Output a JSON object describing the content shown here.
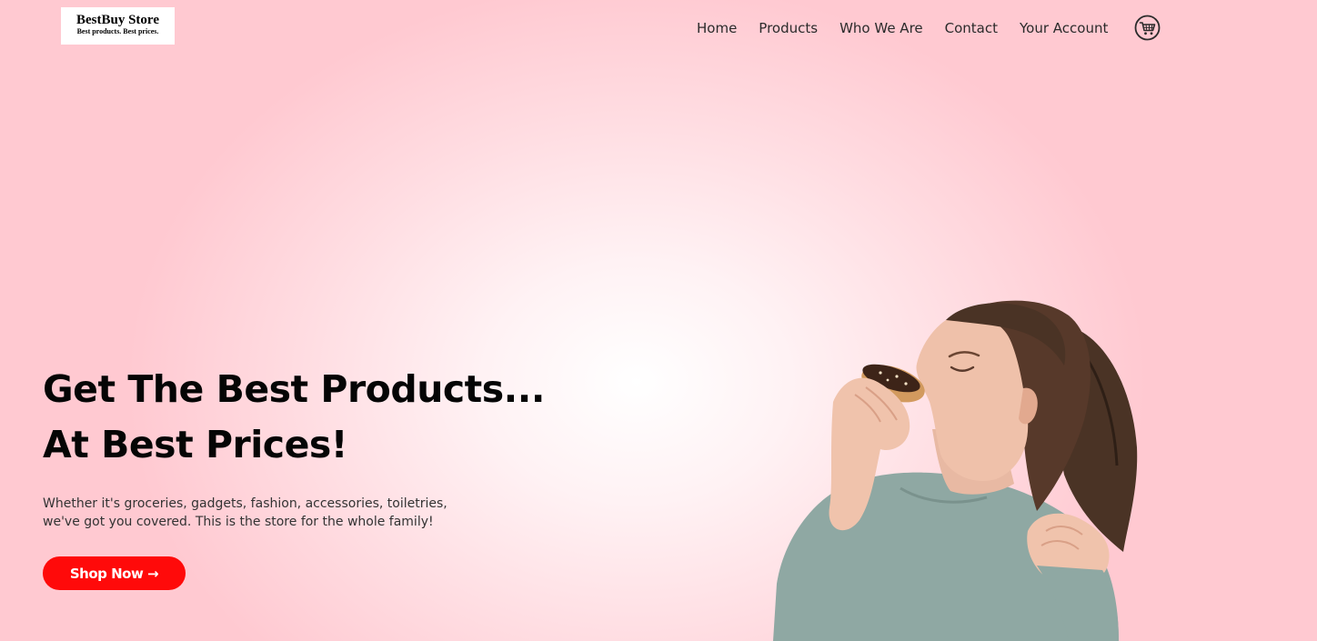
{
  "header": {
    "logo": {
      "name": "BestBuy Store",
      "tagline": "Best products. Best prices."
    },
    "nav": [
      {
        "label": "Home"
      },
      {
        "label": "Products"
      },
      {
        "label": "Who We Are"
      },
      {
        "label": "Contact"
      },
      {
        "label": "Your Account"
      }
    ],
    "cart_icon": "shopping-cart-icon"
  },
  "hero": {
    "title_line1": "Get The Best Products...",
    "title_line2": "At Best Prices!",
    "description_line1": "Whether it's groceries, gadgets, fashion, accessories, toiletries,",
    "description_line2": "we've got you covered. This is the store for the whole family!",
    "cta_label": "Shop Now →",
    "image": "woman-eating-donut"
  },
  "colors": {
    "background": "#ffd5db",
    "cta": "#ff0a0a",
    "text": "#050505"
  }
}
